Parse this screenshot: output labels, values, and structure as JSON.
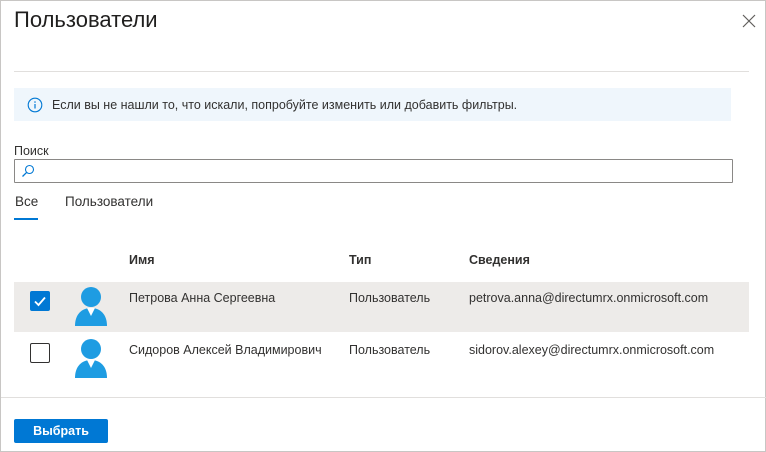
{
  "dialog": {
    "title": "Пользователи",
    "close_icon": "close-icon"
  },
  "info_bar": {
    "icon": "info-icon",
    "text": "Если вы не нашли то, что искали, попробуйте изменить или добавить фильтры."
  },
  "search": {
    "label": "Поиск",
    "value": "",
    "placeholder": "",
    "icon": "search-icon"
  },
  "tabs": [
    {
      "label": "Все",
      "selected": true
    },
    {
      "label": "Пользователи",
      "selected": false
    }
  ],
  "table": {
    "columns": [
      "Имя",
      "Тип",
      "Сведения"
    ],
    "rows": [
      {
        "checked": true,
        "avatar": "user-avatar-icon",
        "name": "Петрова Анна Сергеевна",
        "type": "Пользователь",
        "info": "petrova.anna@directumrx.onmicrosoft.com"
      },
      {
        "checked": false,
        "avatar": "user-avatar-icon",
        "name": "Сидоров Алексей Владимирович",
        "type": "Пользователь",
        "info": "sidorov.alexey@directumrx.onmicrosoft.com"
      }
    ]
  },
  "footer": {
    "select_label": "Выбрать"
  },
  "colors": {
    "accent": "#0078d4",
    "info_bg": "#eff6fc",
    "selected_row_bg": "#edebe9",
    "avatar": "#1e9ce2"
  }
}
